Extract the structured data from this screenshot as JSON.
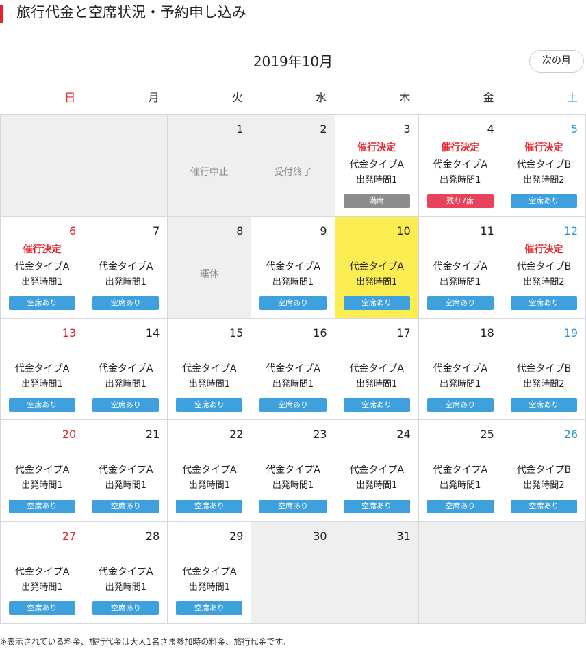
{
  "header": {
    "title": "旅行代金と空席状況・予約申し込み"
  },
  "calendar": {
    "month_title": "2019年10月",
    "next_label": "次の月",
    "weekdays": [
      {
        "label": "日",
        "type": "sun"
      },
      {
        "label": "月",
        "type": ""
      },
      {
        "label": "火",
        "type": ""
      },
      {
        "label": "水",
        "type": ""
      },
      {
        "label": "木",
        "type": ""
      },
      {
        "label": "金",
        "type": ""
      },
      {
        "label": "土",
        "type": "sat"
      }
    ],
    "cells": [
      {
        "kind": "empty"
      },
      {
        "kind": "empty"
      },
      {
        "kind": "closed",
        "day": "1",
        "label": "催行中止"
      },
      {
        "kind": "closed",
        "day": "2",
        "label": "受付終了"
      },
      {
        "kind": "open",
        "day": "3",
        "status": "催行決定",
        "plan": "代金タイプA",
        "time": "出発時間1",
        "badge": "満席",
        "badge_type": "full"
      },
      {
        "kind": "open",
        "day": "4",
        "status": "催行決定",
        "plan": "代金タイプA",
        "time": "出発時間1",
        "badge": "残り7席",
        "badge_type": "few"
      },
      {
        "kind": "open",
        "day": "5",
        "dow": "sat",
        "status": "催行決定",
        "plan": "代金タイプB",
        "time": "出発時間2",
        "badge": "空席あり",
        "badge_type": "avail"
      },
      {
        "kind": "open",
        "day": "6",
        "dow": "sun",
        "status": "催行決定",
        "plan": "代金タイプA",
        "time": "出発時間1",
        "badge": "空席あり",
        "badge_type": "avail"
      },
      {
        "kind": "open",
        "day": "7",
        "plan": "代金タイプA",
        "time": "出発時間1",
        "badge": "空席あり",
        "badge_type": "avail"
      },
      {
        "kind": "closed",
        "day": "8",
        "label": "運休"
      },
      {
        "kind": "open",
        "day": "9",
        "plan": "代金タイプA",
        "time": "出発時間1",
        "badge": "空席あり",
        "badge_type": "avail"
      },
      {
        "kind": "open",
        "day": "10",
        "selected": true,
        "plan": "代金タイプA",
        "time": "出発時間1",
        "badge": "空席あり",
        "badge_type": "avail"
      },
      {
        "kind": "open",
        "day": "11",
        "plan": "代金タイプA",
        "time": "出発時間1",
        "badge": "空席あり",
        "badge_type": "avail"
      },
      {
        "kind": "open",
        "day": "12",
        "dow": "sat",
        "status": "催行決定",
        "plan": "代金タイプB",
        "time": "出発時間2",
        "badge": "空席あり",
        "badge_type": "avail"
      },
      {
        "kind": "open",
        "day": "13",
        "dow": "sun",
        "plan": "代金タイプA",
        "time": "出発時間1",
        "badge": "空席あり",
        "badge_type": "avail"
      },
      {
        "kind": "open",
        "day": "14",
        "plan": "代金タイプA",
        "time": "出発時間1",
        "badge": "空席あり",
        "badge_type": "avail"
      },
      {
        "kind": "open",
        "day": "15",
        "plan": "代金タイプA",
        "time": "出発時間1",
        "badge": "空席あり",
        "badge_type": "avail"
      },
      {
        "kind": "open",
        "day": "16",
        "plan": "代金タイプA",
        "time": "出発時間1",
        "badge": "空席あり",
        "badge_type": "avail"
      },
      {
        "kind": "open",
        "day": "17",
        "plan": "代金タイプA",
        "time": "出発時間1",
        "badge": "空席あり",
        "badge_type": "avail"
      },
      {
        "kind": "open",
        "day": "18",
        "plan": "代金タイプA",
        "time": "出発時間1",
        "badge": "空席あり",
        "badge_type": "avail"
      },
      {
        "kind": "open",
        "day": "19",
        "dow": "sat",
        "plan": "代金タイプB",
        "time": "出発時間2",
        "badge": "空席あり",
        "badge_type": "avail"
      },
      {
        "kind": "open",
        "day": "20",
        "dow": "sun",
        "plan": "代金タイプA",
        "time": "出発時間1",
        "badge": "空席あり",
        "badge_type": "avail"
      },
      {
        "kind": "open",
        "day": "21",
        "plan": "代金タイプA",
        "time": "出発時間1",
        "badge": "空席あり",
        "badge_type": "avail"
      },
      {
        "kind": "open",
        "day": "22",
        "plan": "代金タイプA",
        "time": "出発時間1",
        "badge": "空席あり",
        "badge_type": "avail"
      },
      {
        "kind": "open",
        "day": "23",
        "plan": "代金タイプA",
        "time": "出発時間1",
        "badge": "空席あり",
        "badge_type": "avail"
      },
      {
        "kind": "open",
        "day": "24",
        "plan": "代金タイプA",
        "time": "出発時間1",
        "badge": "空席あり",
        "badge_type": "avail"
      },
      {
        "kind": "open",
        "day": "25",
        "plan": "代金タイプA",
        "time": "出発時間1",
        "badge": "空席あり",
        "badge_type": "avail"
      },
      {
        "kind": "open",
        "day": "26",
        "dow": "sat",
        "plan": "代金タイプB",
        "time": "出発時間2",
        "badge": "空席あり",
        "badge_type": "avail"
      },
      {
        "kind": "open",
        "day": "27",
        "dow": "sun",
        "plan": "代金タイプA",
        "time": "出発時間1",
        "badge": "空席あり",
        "badge_type": "avail"
      },
      {
        "kind": "open",
        "day": "28",
        "plan": "代金タイプA",
        "time": "出発時間1",
        "badge": "空席あり",
        "badge_type": "avail"
      },
      {
        "kind": "open",
        "day": "29",
        "plan": "代金タイプA",
        "time": "出発時間1",
        "badge": "空席あり",
        "badge_type": "avail"
      },
      {
        "kind": "closed",
        "day": "30",
        "label": ""
      },
      {
        "kind": "closed",
        "day": "31",
        "label": ""
      },
      {
        "kind": "empty"
      },
      {
        "kind": "empty"
      }
    ]
  },
  "footer": {
    "note": "※表示されている料金、旅行代金は大人1名さま参加時の料金、旅行代金です。"
  },
  "colors": {
    "accent_red": "#e4232c",
    "saturday_blue": "#2e95d3",
    "available_blue": "#3ea0dc",
    "few_seats_red": "#e9435b",
    "full_gray": "#8c8c8c",
    "selected_yellow": "#fbed52"
  }
}
